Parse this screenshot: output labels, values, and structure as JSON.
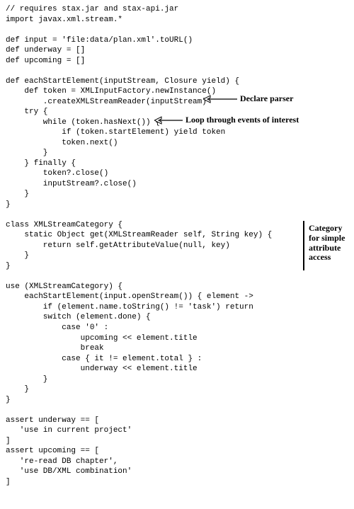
{
  "code": {
    "l01": "// requires stax.jar and stax-api.jar",
    "l02": "import javax.xml.stream.*",
    "l03": "",
    "l04": "def input = 'file:data/plan.xml'.toURL()",
    "l05": "def underway = []",
    "l06": "def upcoming = []",
    "l07": "",
    "l08": "def eachStartElement(inputStream, Closure yield) {",
    "l09": "    def token = XMLInputFactory.newInstance()",
    "l10": "        .createXMLStreamReader(inputStream)",
    "l11": "    try {",
    "l12": "        while (token.hasNext()) {",
    "l13": "            if (token.startElement) yield token",
    "l14": "            token.next()",
    "l15": "        }",
    "l16": "    } finally {",
    "l17": "        token?.close()",
    "l18": "        inputStream?.close()",
    "l19": "    }",
    "l20": "}",
    "l21": "",
    "l22": "class XMLStreamCategory {",
    "l23": "    static Object get(XMLStreamReader self, String key) {",
    "l24": "        return self.getAttributeValue(null, key)",
    "l25": "    }",
    "l26": "}",
    "l27": "",
    "l28": "use (XMLStreamCategory) {",
    "l29": "    eachStartElement(input.openStream()) { element ->",
    "l30": "        if (element.name.toString() != 'task') return",
    "l31": "        switch (element.done) {",
    "l32": "            case '0' :",
    "l33": "                upcoming << element.title",
    "l34": "                break",
    "l35": "            case { it != element.total } :",
    "l36": "                underway << element.title",
    "l37": "        }",
    "l38": "    }",
    "l39": "}",
    "l40": "",
    "l41": "assert underway == [",
    "l42": "   'use in current project'",
    "l43": "]",
    "l44": "assert upcoming == [",
    "l45": "   're-read DB chapter',",
    "l46": "   'use DB/XML combination'",
    "l47": "]"
  },
  "annotations": {
    "declare_parser": "Declare parser",
    "loop_events": "Loop through events of interest",
    "category_access": "Category for simple attribute access"
  }
}
